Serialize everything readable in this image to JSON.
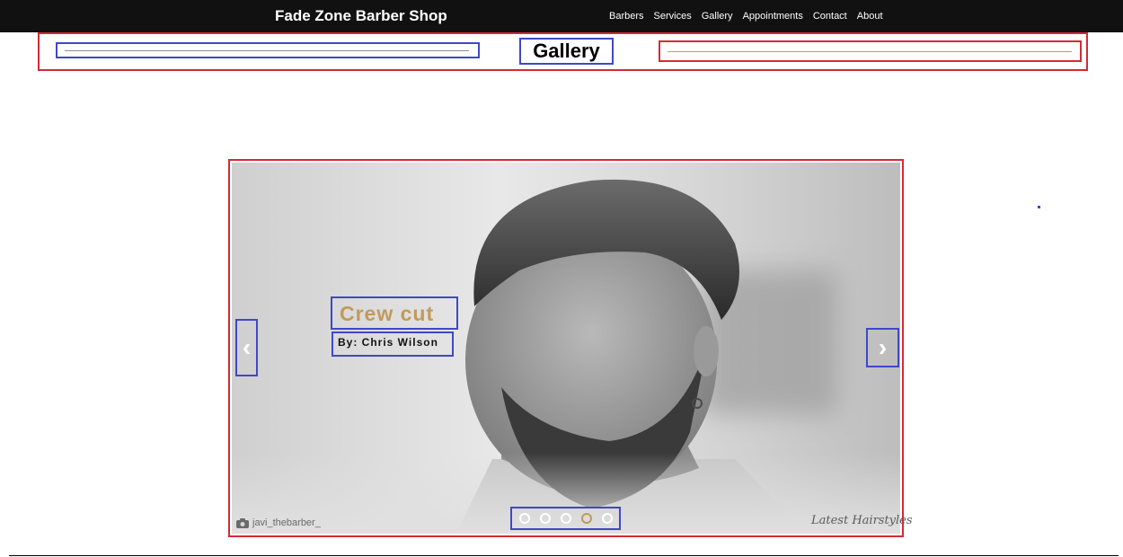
{
  "header": {
    "brand": "Fade Zone Barber Shop",
    "nav": [
      "Barbers",
      "Services",
      "Gallery",
      "Appointments",
      "Contact",
      "About"
    ]
  },
  "section": {
    "title": "Gallery"
  },
  "carousel": {
    "caption_title": "Crew cut",
    "caption_author": "By: Chris Wilson",
    "prev_glyph": "‹",
    "next_glyph": "›",
    "indicator_count": 5,
    "active_index": 3,
    "photo_credit": "javi_thebarber_",
    "watermark": "Latest Hairstyles"
  },
  "colors": {
    "navbar": "#111111",
    "annotation_red": "#d42a35",
    "annotation_blue": "#3f48c6",
    "caption_gold": "#c19a5b"
  },
  "icons": {
    "credit": "camera-icon",
    "prev": "chevron-left-icon",
    "next": "chevron-right-icon"
  }
}
